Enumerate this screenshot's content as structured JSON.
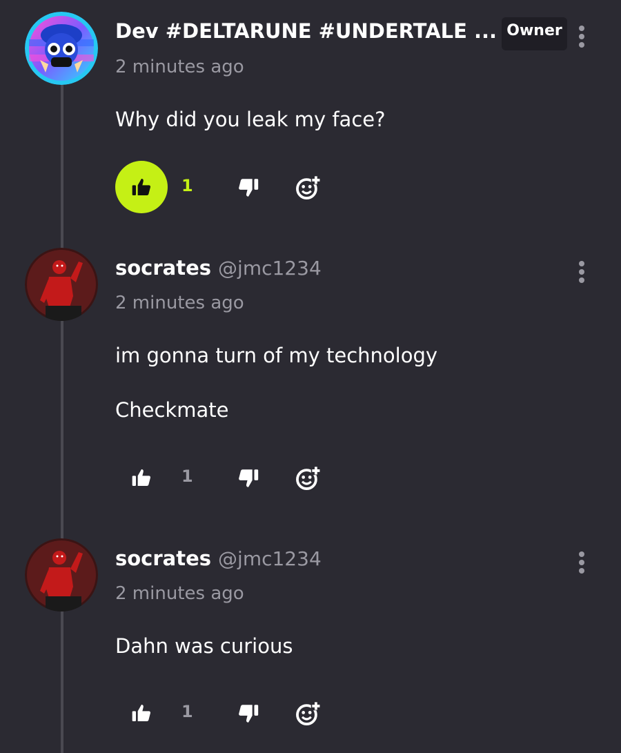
{
  "comments": [
    {
      "author": "Dev #DELTARUNE #UNDERTALE ...",
      "handle": "",
      "badge": "Owner",
      "time": "2 minutes ago",
      "body": [
        "Why did you leak my face?"
      ],
      "likes": "1",
      "liked": true,
      "avatar": "blue-masked-character-avatar"
    },
    {
      "author": "socrates",
      "handle": "@jmc1234",
      "badge": "",
      "time": "2 minutes ago",
      "body": [
        "im gonna turn of my technology",
        "Checkmate"
      ],
      "likes": "1",
      "liked": false,
      "avatar": "red-figure-avatar"
    },
    {
      "author": "socrates",
      "handle": "@jmc1234",
      "badge": "",
      "time": "2 minutes ago",
      "body": [
        "Dahn was curious"
      ],
      "likes": "1",
      "liked": false,
      "avatar": "red-figure-avatar"
    }
  ],
  "colors": {
    "background": "#2b2a32",
    "accent": "#c5f015",
    "muted": "#9a99a2",
    "thread_line": "#4a4951"
  },
  "icons": {
    "like": "thumbs-up-icon",
    "dislike": "thumbs-down-icon",
    "react": "add-reaction-icon",
    "more": "more-vertical-icon"
  }
}
